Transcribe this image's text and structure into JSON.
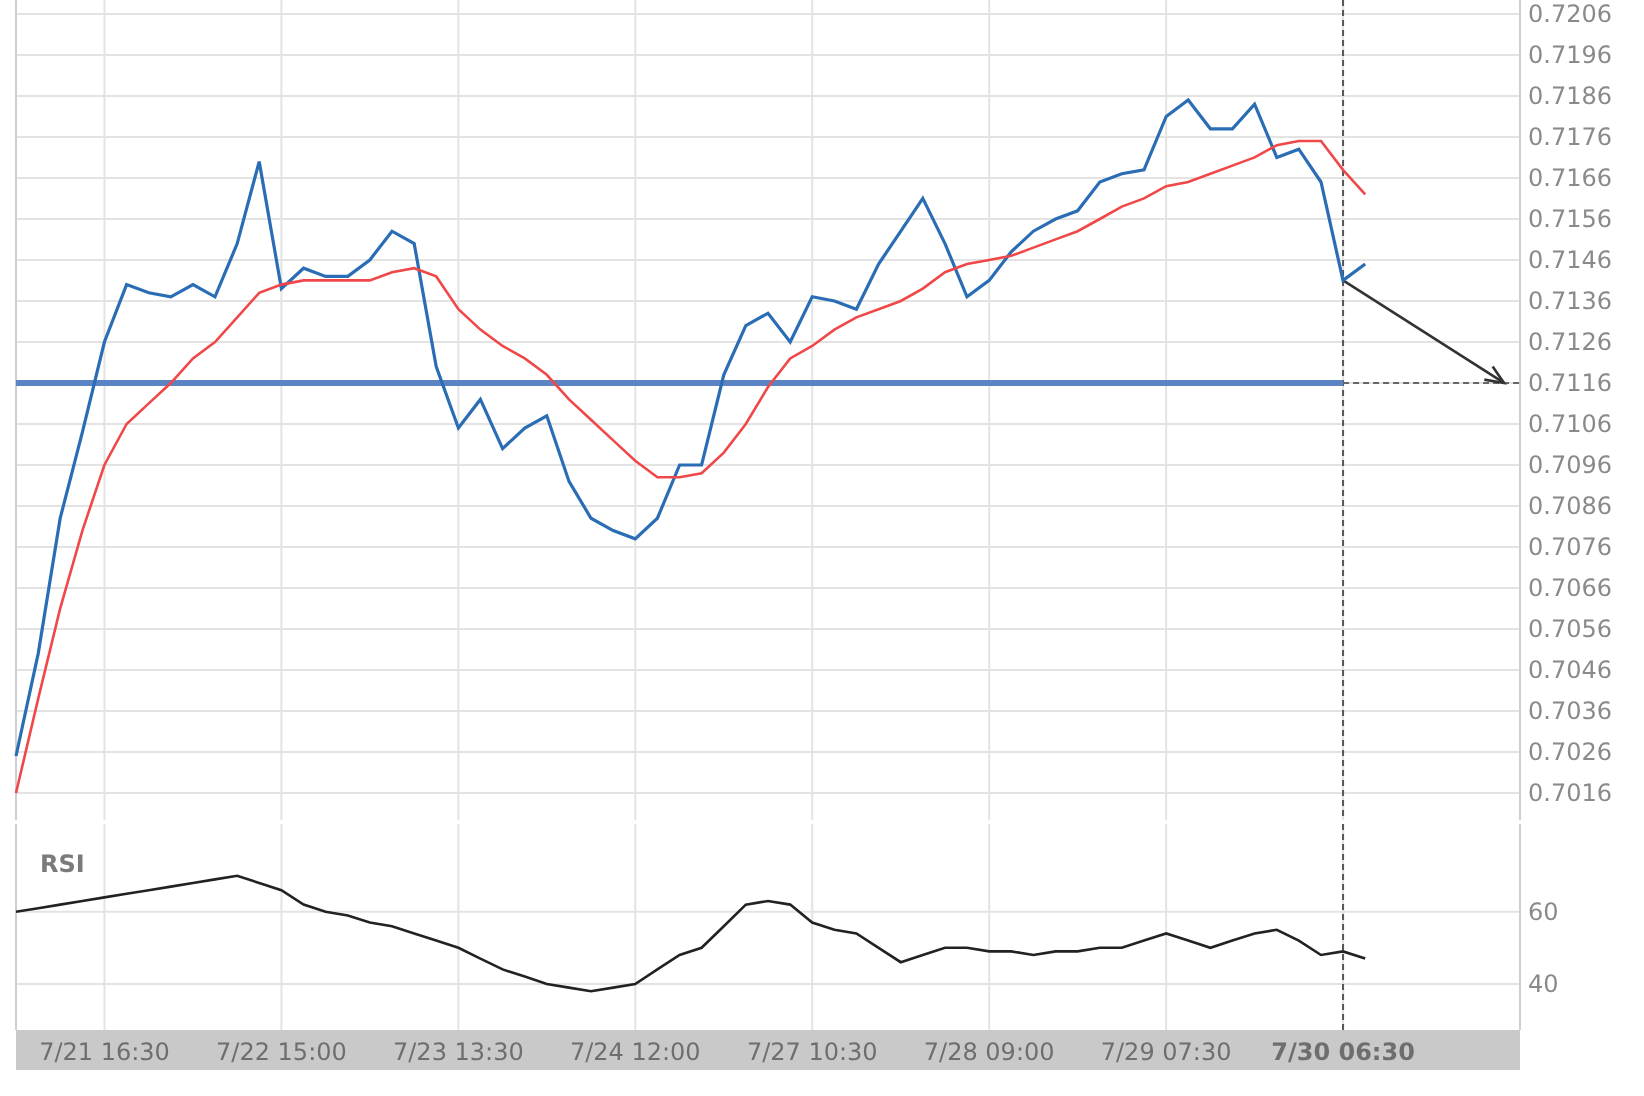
{
  "price_panel": {
    "chart_data": {
      "type": "line",
      "categories": [
        null,
        null,
        null,
        null,
        null,
        null,
        null,
        null,
        null,
        null,
        null,
        null,
        null,
        null,
        null,
        null,
        null,
        null,
        null,
        null,
        null,
        null,
        null,
        null,
        null,
        null,
        null,
        null,
        null,
        null,
        null,
        null,
        null,
        null,
        null,
        null,
        null,
        null,
        null,
        null,
        null,
        null,
        null,
        null,
        null,
        null,
        null,
        null,
        null,
        null,
        null,
        null,
        null,
        null,
        null,
        null,
        null,
        null,
        null,
        null,
        null,
        null
      ],
      "series": [
        {
          "color": "#2a6db5",
          "values": [
            0.7025,
            0.705,
            0.7083,
            0.7104,
            0.7126,
            0.714,
            0.7138,
            0.7137,
            0.714,
            0.7137,
            0.715,
            0.717,
            0.7139,
            0.7144,
            0.7142,
            0.7142,
            0.7146,
            0.7153,
            0.715,
            0.712,
            0.7105,
            0.7112,
            0.71,
            0.7105,
            0.7108,
            0.7092,
            0.7083,
            0.708,
            0.7078,
            0.7083,
            0.7096,
            0.7096,
            0.7118,
            0.713,
            0.7133,
            0.7126,
            0.7137,
            0.7136,
            0.7134,
            0.7145,
            0.7153,
            0.7161,
            0.715,
            0.7137,
            0.7141,
            0.7148,
            0.7153,
            0.7156,
            0.7158,
            0.7165,
            0.7167,
            0.7168,
            0.7181,
            0.7185,
            0.7178,
            0.7178,
            0.7184,
            0.7171,
            0.7173,
            0.7165,
            0.7141,
            0.7145
          ]
        },
        {
          "color": "#f04848",
          "values": [
            0.7016,
            0.7039,
            0.7061,
            0.708,
            0.7096,
            0.7106,
            0.7111,
            0.7116,
            0.7122,
            0.7126,
            0.7132,
            0.7138,
            0.714,
            0.7141,
            0.7141,
            0.7141,
            0.7141,
            0.7143,
            0.7144,
            0.7142,
            0.7134,
            0.7129,
            0.7125,
            0.7122,
            0.7118,
            0.7112,
            0.7107,
            0.7102,
            0.7097,
            0.7093,
            0.7093,
            0.7094,
            0.7099,
            0.7106,
            0.7115,
            0.7122,
            0.7125,
            0.7129,
            0.7132,
            0.7134,
            0.7136,
            0.7139,
            0.7143,
            0.7145,
            0.7146,
            0.7147,
            0.7149,
            0.7151,
            0.7153,
            0.7156,
            0.7159,
            0.7161,
            0.7164,
            0.7165,
            0.7167,
            0.7169,
            0.7171,
            0.7174,
            0.7175,
            0.7175,
            0.7168,
            0.7162
          ]
        }
      ],
      "ylim": [
        0.70094,
        0.72094
      ],
      "grid": true,
      "yticks": [
        0.7206,
        0.7196,
        0.7186,
        0.7176,
        0.7166,
        0.7156,
        0.7146,
        0.7136,
        0.7126,
        0.7116,
        0.7106,
        0.7096,
        0.7086,
        0.7076,
        0.7066,
        0.7056,
        0.7046,
        0.7036,
        0.7026,
        0.7016
      ],
      "ref_lines": [
        {
          "axis": "y",
          "value": 0.7116
        }
      ]
    }
  },
  "rsi_panel": {
    "chart_data": {
      "type": "line",
      "title": "RSI",
      "categories": [
        null,
        null,
        null,
        null,
        "7/21 16:30",
        null,
        null,
        null,
        null,
        null,
        null,
        null,
        "7/22 15:00",
        null,
        null,
        null,
        null,
        null,
        null,
        null,
        "7/23 13:30",
        null,
        null,
        null,
        null,
        null,
        null,
        null,
        "7/24 12:00",
        null,
        null,
        null,
        null,
        null,
        null,
        null,
        "7/27 10:30",
        null,
        null,
        null,
        null,
        null,
        null,
        null,
        "7/28 09:00",
        null,
        null,
        null,
        null,
        null,
        null,
        null,
        "7/29 07:30",
        null,
        null,
        null,
        null,
        null,
        null,
        null,
        "7/30 06:30",
        null
      ],
      "series": [
        {
          "color": "#222222",
          "values": [
            60,
            61,
            62,
            63,
            64,
            65,
            66,
            67,
            68,
            69,
            70,
            68,
            66,
            62,
            60,
            59,
            57,
            56,
            54,
            52,
            50,
            47,
            44,
            42,
            40,
            39,
            38,
            39,
            40,
            44,
            48,
            50,
            56,
            62,
            63,
            62,
            57,
            55,
            54,
            50,
            46,
            48,
            50,
            50,
            49,
            49,
            48,
            49,
            49,
            50,
            50,
            52,
            54,
            52,
            50,
            52,
            54,
            55,
            52,
            48,
            49,
            47
          ]
        }
      ],
      "ylim": [
        27.2,
        84.4
      ],
      "grid": true,
      "yticks": [
        60,
        40
      ]
    }
  }
}
